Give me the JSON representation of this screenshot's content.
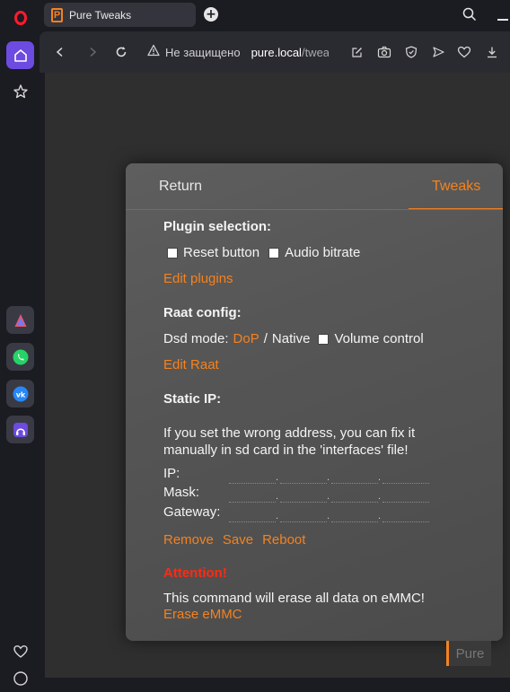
{
  "browser": {
    "tab_title": "Pure Tweaks",
    "tab_favicon_letter": "P",
    "security_warning": "Не защищено",
    "url_host": "pure.local",
    "url_path": "/twea",
    "sidebar_icons": [
      "opera-logo-icon",
      "home-icon",
      "star-icon",
      "aria-icon",
      "whatsapp-icon",
      "vk-icon",
      "music-icon",
      "heart-icon",
      "clock-icon"
    ],
    "accent_color": "#6c4be0"
  },
  "dialog": {
    "tabs": {
      "return_label": "Return",
      "tweaks_label": "Tweaks"
    },
    "plugins": {
      "heading": "Plugin selection:",
      "reset_button_label": "Reset button",
      "audio_bitrate_label": "Audio bitrate",
      "edit_link": "Edit plugins"
    },
    "raat": {
      "heading": "Raat config:",
      "dsd_mode_label": "Dsd mode:",
      "dsd_option_dop": "DoP",
      "dsd_separator": "/",
      "dsd_option_native": "Native",
      "volume_control_label": "Volume control",
      "edit_link": "Edit Raat"
    },
    "static_ip": {
      "heading": "Static IP:",
      "warning_text": "If you set the wrong address, you can fix it manually in sd card in the 'interfaces' file!",
      "ip_label": "IP:",
      "mask_label": "Mask:",
      "gateway_label": "Gateway:",
      "dot": ".",
      "remove_label": "Remove",
      "save_label": "Save",
      "reboot_label": "Reboot"
    },
    "emmc": {
      "attention": "Attention!",
      "message": "This command will erase all data on eMMC!",
      "erase_link": "Erase eMMC"
    }
  },
  "footer_tag": "Pure"
}
